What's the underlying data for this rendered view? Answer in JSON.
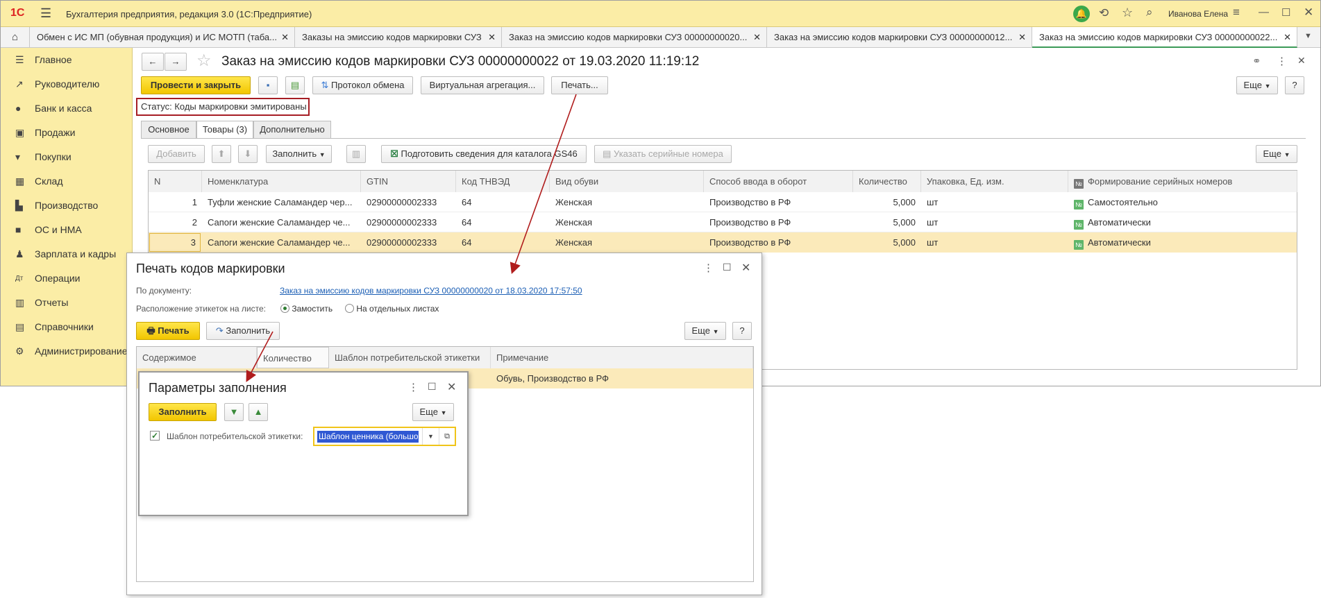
{
  "app": {
    "logo": "1С",
    "title": "Бухгалтерия предприятия, редакция 3.0  (1С:Предприятие)",
    "user": "Иванова Елена"
  },
  "tabs": [
    {
      "label": "Обмен с ИС МП (обувная продукция) и ИС МОТП (таба..."
    },
    {
      "label": "Заказы на эмиссию кодов маркировки СУЗ"
    },
    {
      "label": "Заказ на эмиссию кодов маркировки СУЗ 00000000020..."
    },
    {
      "label": "Заказ на эмиссию кодов маркировки СУЗ 00000000012..."
    },
    {
      "label": "Заказ на эмиссию кодов маркировки СУЗ 00000000022..."
    }
  ],
  "sidebar": {
    "items": [
      {
        "label": "Главное",
        "icon": "menu-icon"
      },
      {
        "label": "Руководителю",
        "icon": "chart-icon"
      },
      {
        "label": "Банк и касса",
        "icon": "coin-icon"
      },
      {
        "label": "Продажи",
        "icon": "bag-icon"
      },
      {
        "label": "Покупки",
        "icon": "cart-icon"
      },
      {
        "label": "Склад",
        "icon": "warehouse-icon"
      },
      {
        "label": "Производство",
        "icon": "factory-icon"
      },
      {
        "label": "ОС и НМА",
        "icon": "truck-icon"
      },
      {
        "label": "Зарплата и кадры",
        "icon": "person-icon"
      },
      {
        "label": "Операции",
        "icon": "dt-kt-icon"
      },
      {
        "label": "Отчеты",
        "icon": "bar-chart-icon"
      },
      {
        "label": "Справочники",
        "icon": "book-icon"
      },
      {
        "label": "Администрирование",
        "icon": "gear-icon"
      }
    ]
  },
  "document": {
    "title": "Заказ на эмиссию кодов маркировки СУЗ 00000000022 от 19.03.2020 11:19:12",
    "post_close": "Провести и закрыть",
    "protocol": "Протокол обмена",
    "virtual_agg": "Виртуальная агрегация...",
    "print": "Печать...",
    "more": "Еще",
    "help": "?",
    "status": "Статус: Коды маркировки эмитированы",
    "doc_tabs": [
      "Основное",
      "Товары (3)",
      "Дополнительно"
    ],
    "toolbar": {
      "add": "Добавить",
      "fill": "Заполнить",
      "prepare_gs46": "Подготовить сведения для каталога GS46",
      "serial": "Указать серийные номера",
      "more": "Еще"
    },
    "table": {
      "headers": [
        "N",
        "Номенклатура",
        "GTIN",
        "Код ТНВЭД",
        "Вид обуви",
        "Способ ввода в оборот",
        "Количество",
        "Упаковка, Ед. изм.",
        "Формирование серийных номеров"
      ],
      "rows": [
        [
          "1",
          "Туфли женские Саламандер чер...",
          "02900000002333",
          "64",
          "Женская",
          "Производство в РФ",
          "5,000",
          "шт",
          "Самостоятельно"
        ],
        [
          "2",
          "Сапоги женские Саламандер че...",
          "02900000002333",
          "64",
          "Женская",
          "Производство в РФ",
          "5,000",
          "шт",
          "Автоматически"
        ],
        [
          "3",
          "Сапоги женские Саламандер че...",
          "02900000002333",
          "64",
          "Женская",
          "Производство в РФ",
          "5,000",
          "шт",
          "Автоматически"
        ]
      ]
    }
  },
  "print_dialog": {
    "title": "Печать кодов маркировки",
    "doc_label": "По документу:",
    "doc_link": "Заказ на эмиссию кодов маркировки СУЗ 00000000020 от 18.03.2020 17:57:50",
    "layout_label": "Расположение этикеток на листе:",
    "option_tile": "Замостить",
    "option_separate": "На отдельных листах",
    "print_btn": "Печать",
    "fill_btn": "Заполнить",
    "more": "Еще",
    "help": "?",
    "headers": [
      "Содержимое",
      "Количество",
      "Шаблон потребительской этикетки",
      "Примечание"
    ],
    "row_note": "Обувь, Производство в РФ"
  },
  "fill_dialog": {
    "title": "Параметры заполнения",
    "fill_btn": "Заполнить",
    "more": "Еще",
    "checkbox_label": "Шаблон потребительской этикетки:",
    "template_value": "Шаблон ценника (большо"
  },
  "colors": {
    "accent_yellow": "#fbeda6",
    "button_yellow": "#f2c600",
    "selection": "#fbeaba",
    "status_border": "#a61d24",
    "arrow": "#b01c1c"
  }
}
